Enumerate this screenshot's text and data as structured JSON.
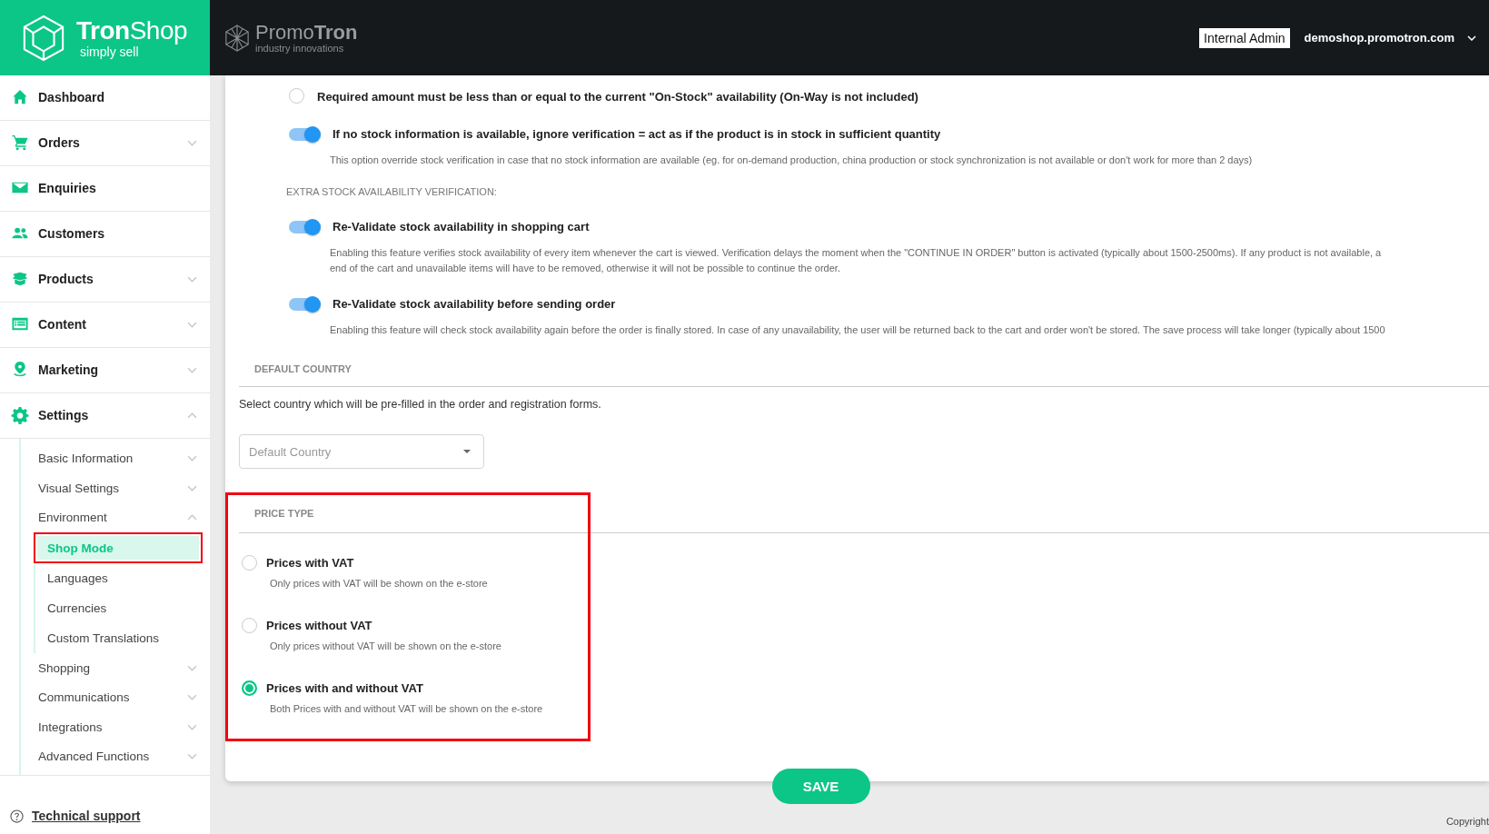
{
  "header": {
    "logo": {
      "name": "**Tron**Shop",
      "tagline": "simply sell"
    },
    "partner_logo": {
      "name": "Promo**Tron**",
      "tagline": "industry innovations"
    },
    "user_role": "Internal Admin",
    "domain": "demoshop.promotron.com"
  },
  "sidebar": {
    "items": [
      {
        "label": "Dashboard"
      },
      {
        "label": "Orders",
        "expanded": false
      },
      {
        "label": "Enquiries"
      },
      {
        "label": "Customers"
      },
      {
        "label": "Products",
        "expanded": false
      },
      {
        "label": "Content",
        "expanded": false
      },
      {
        "label": "Marketing",
        "expanded": false
      },
      {
        "label": "Settings",
        "expanded": true,
        "children": [
          {
            "label": "Basic Information",
            "expanded": false
          },
          {
            "label": "Visual Settings",
            "expanded": false
          },
          {
            "label": "Environment",
            "expanded": true,
            "children": [
              {
                "label": "Shop Mode",
                "selected": true,
                "highlighted": true
              },
              {
                "label": "Languages",
                "selected": false,
                "highlighted": false
              },
              {
                "label": "Currencies",
                "selected": false,
                "highlighted": false
              },
              {
                "label": "Custom Translations",
                "selected": false,
                "highlighted": false
              }
            ]
          },
          {
            "label": "Shopping",
            "expanded": false
          },
          {
            "label": "Communications",
            "expanded": false
          },
          {
            "label": "Integrations",
            "expanded": false
          },
          {
            "label": "Advanced Functions",
            "expanded": false
          }
        ]
      }
    ],
    "technical_support": "Technical support"
  },
  "stock_options": [
    {
      "kind": "radio",
      "label": "Required amount must be less than or equal to the current \"On-Stock\" availability (On-Way is not included)",
      "selected": false
    },
    {
      "kind": "toggle",
      "label": "If no stock information is available, ignore verification = act as if the product is in stock in sufficient quantity",
      "on": true,
      "description": [
        "This option override stock verification in case that no stock information are available (eg. for on-demand production, china production or stock synchronization is not available or don't work for more than 2 days)"
      ]
    }
  ],
  "extra_verification": {
    "title": "EXTRA STOCK AVAILABILITY VERIFICATION:",
    "items": [
      {
        "kind": "toggle",
        "label": "Re-Validate stock availability in shopping cart",
        "on": true,
        "description": [
          "Enabling this feature verifies stock availability of every item whenever the cart is viewed. Verification delays the moment when the \"CONTINUE IN ORDER\" button is activated (typically about 1500-2500ms). If any product is not available, a",
          "end of the cart and unavailable items will have to be removed, otherwise it will not be possible to continue the order."
        ]
      },
      {
        "kind": "toggle",
        "label": "Re-Validate stock availability before sending order",
        "on": true,
        "description": [
          "Enabling this feature will check stock availability again before the order is finally stored. In case of any unavailability, the user will be returned back to the cart and order won't be stored. The save process will take longer (typically about 1500"
        ]
      }
    ]
  },
  "default_country": {
    "title": "DEFAULT COUNTRY",
    "description": "Select country which will be pre-filled in the order and registration forms.",
    "select": {
      "placeholder": "Default Country"
    }
  },
  "price_type": {
    "title": "PRICE TYPE",
    "highlighted": true,
    "options": [
      {
        "label": "Prices with VAT",
        "description": "Only prices with VAT will be shown on the e-store",
        "selected": false
      },
      {
        "label": "Prices without VAT",
        "description": "Only prices without VAT will be shown on the e-store",
        "selected": false
      },
      {
        "label": "Prices with and without VAT",
        "description": "Both Prices with and without VAT will be shown on the e-store",
        "selected": true
      }
    ]
  },
  "save_button": "SAVE",
  "footer": {
    "copyright": "Copyright"
  }
}
